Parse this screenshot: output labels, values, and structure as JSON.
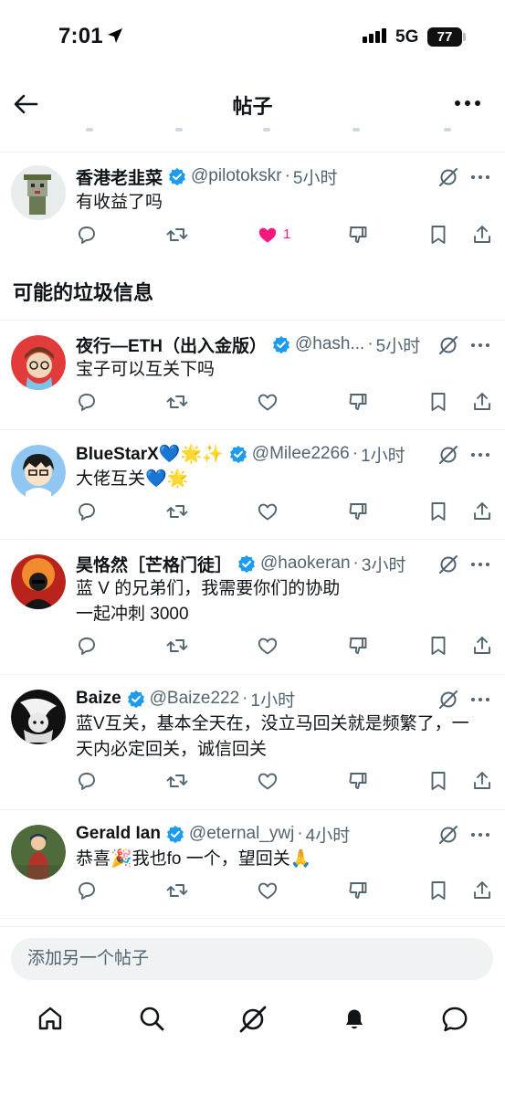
{
  "status_bar": {
    "time": "7:01",
    "network": "5G",
    "battery": "77"
  },
  "header": {
    "title": "帖子"
  },
  "top_post": {
    "name": "香港老韭菜",
    "handle": "@pilotokskr",
    "time": "5小时",
    "text": [
      "有收益了吗"
    ],
    "likes": "1",
    "liked": true
  },
  "section": {
    "title": "可能的垃圾信息"
  },
  "posts": [
    {
      "name": "夜行—ETH（出入金版）",
      "handle": "@hash...",
      "time": "5小时",
      "text": [
        "宝子可以互关下吗"
      ]
    },
    {
      "name": "BlueStarX💙🌟✨",
      "handle": "@Milee2266",
      "time": "1小时",
      "text": [
        "大佬互关💙🌟"
      ]
    },
    {
      "name": "昊恪然［芒格门徒］",
      "handle": "@haokeran",
      "time": "3小时",
      "text": [
        "蓝 V 的兄弟们，我需要你们的协助",
        "一起冲刺 3000"
      ]
    },
    {
      "name": "Baize",
      "handle": "@Baize222",
      "time": "1小时",
      "text": [
        "蓝V互关，基本全天在，没立马回关就是频繁了，一",
        "天内必定回关，诚信回关"
      ]
    },
    {
      "name": "Gerald Ian",
      "handle": "@eternal_ywj",
      "time": "4小时",
      "text": [
        "恭喜🎉我也fo 一个，望回关🙏"
      ]
    }
  ],
  "reply": {
    "placeholder": "添加另一个帖子"
  },
  "colors": {
    "accent": "#1d9bf0",
    "like": "#f91880",
    "text": "#0f1419",
    "muted": "#536471"
  },
  "icons": {
    "actions": [
      "reply-icon",
      "retweet-icon",
      "like-icon",
      "downvote-icon",
      "bookmark-icon",
      "share-icon"
    ],
    "tabs": [
      "home-icon",
      "search-icon",
      "grok-icon",
      "notifications-icon",
      "messages-icon"
    ]
  }
}
